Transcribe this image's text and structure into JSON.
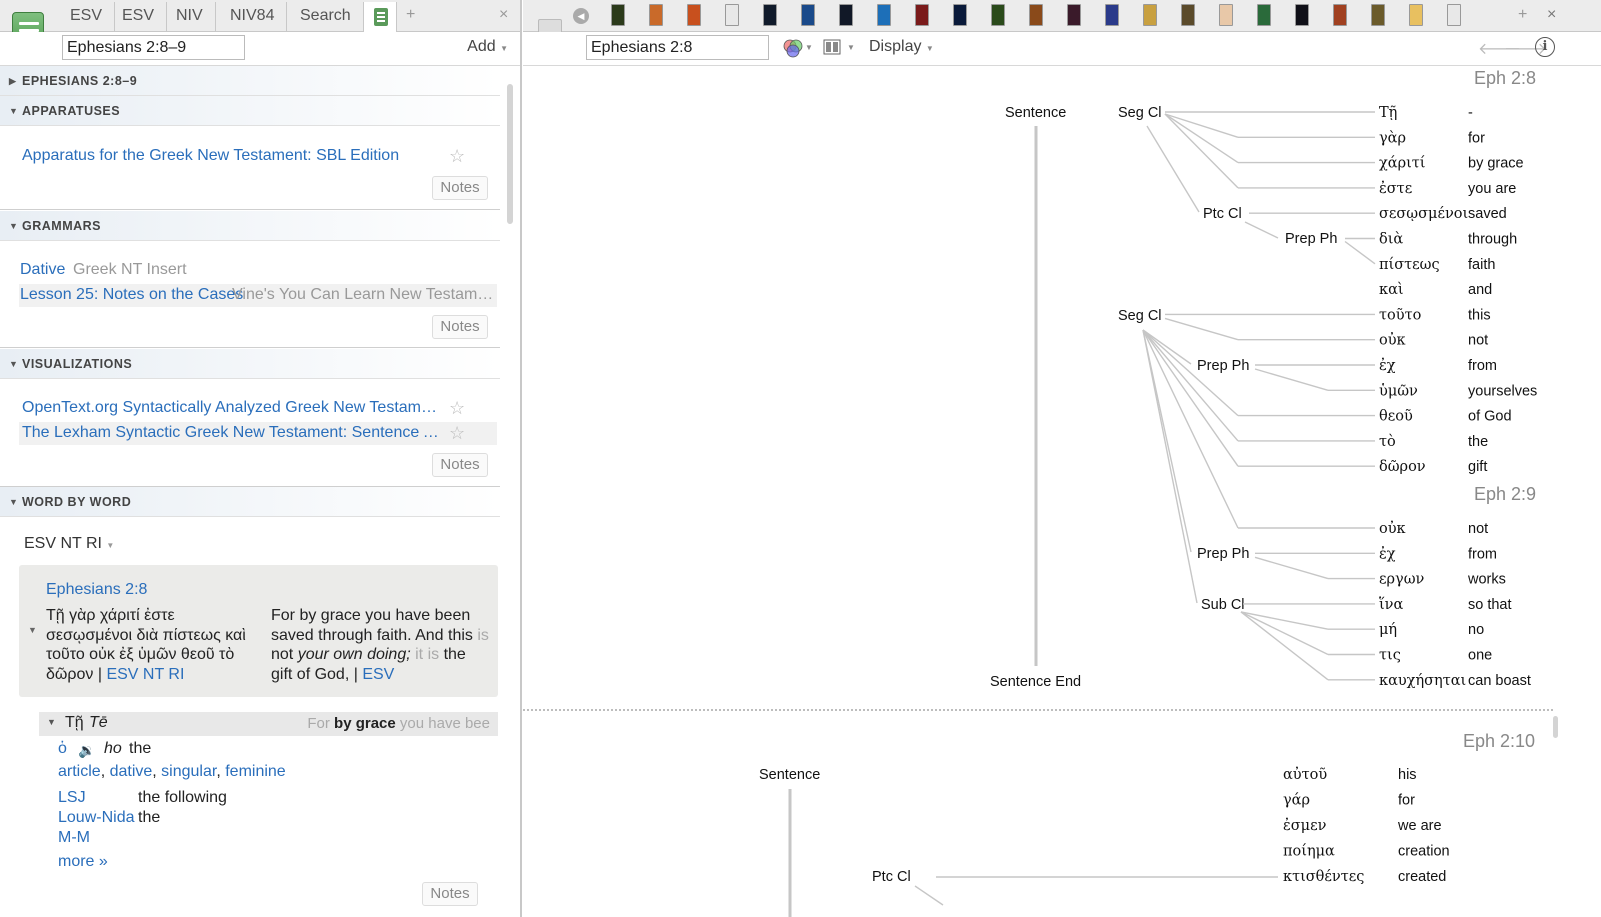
{
  "left": {
    "tabs": [
      "ESV",
      "ESV",
      "NIV",
      "NIV84",
      "Search"
    ],
    "reference": "Ephesians 2:8–9",
    "add_label": "Add",
    "sections": {
      "passage": "EPHESIANS 2:8–9",
      "apparatuses": "APPARATUSES",
      "grammars": "GRAMMARS",
      "visualizations": "VISUALIZATIONS",
      "word_by_word": "WORD BY WORD"
    },
    "apparatus_item": "Apparatus for the Greek New Testament: SBL Edition",
    "grammar_items": [
      {
        "title": "Dative",
        "source": "Greek NT Insert"
      },
      {
        "title": "Lesson 25: Notes on the Cases",
        "source": "Vine's You Can Learn New Testament..."
      }
    ],
    "visualization_items": [
      "OpenText.org Syntactically Analyzed Greek New Testament:...",
      "The Lexham Syntactic Greek New Testament: Sentence Ana..."
    ],
    "notes_label": "Notes",
    "wbw": {
      "resource": "ESV NT RI",
      "verse_ref": "Ephesians 2:8",
      "greek": "Τῇ γὰρ χάριτί ἐστε σεσῳσμένοι διὰ πίστεως καὶ τοῦτο οὐκ ἐξ ὑμῶν θεοῦ τὸ δῶρον",
      "greek_src": "ESV NT RI",
      "eng_1": "For by grace you have been saved through faith. And this",
      "eng_is": "is",
      "eng_2": "not",
      "eng_italic": "your own doing;",
      "eng_itis": "it is",
      "eng_3": "the gift of God,",
      "eng_src": "ESV",
      "word_greek": "Τῇ",
      "word_translit": "Tē",
      "ctx_pre": "For",
      "ctx_bold": "by grace",
      "ctx_post": "you have bee",
      "lemma": "ὁ",
      "lemma_translit": "ho",
      "lemma_gloss": "the",
      "parsing": [
        "article",
        "dative",
        "singular",
        "feminine"
      ],
      "lexicons": [
        {
          "name": "LSJ",
          "def": "the following"
        },
        {
          "name": "Louw-Nida",
          "def": "the"
        },
        {
          "name": "M-M",
          "def": ""
        }
      ],
      "more": "more »"
    }
  },
  "right": {
    "reference": "Ephesians 2:8",
    "display_label": "Display",
    "book_colors": [
      "#2b3a1a",
      "#c96a2a",
      "#c8501e",
      "#e8e8e8",
      "#101a2a",
      "#1a4a8a",
      "#111827",
      "#1d6fb8",
      "#7a1a1a",
      "#0a1a3a",
      "#2a4a1a",
      "#8a4a1a",
      "#3a1a2a",
      "#2a3a8a",
      "#c8a040",
      "#5a4a2a",
      "#e8c8a8",
      "#2a6a3a",
      "#101018",
      "#a04020",
      "#6a5a2a",
      "#e8c060",
      "#e8e8e8"
    ],
    "diagram1": {
      "verse_ref_1": "Eph 2:8",
      "verse_ref_2": "Eph 2:9",
      "sentence": "Sentence",
      "sentence_end": "Sentence End",
      "nodes": {
        "seg1": "Seg Cl",
        "ptc": "Ptc Cl",
        "prep1": "Prep Ph",
        "seg2": "Seg Cl",
        "prep2": "Prep Ph",
        "prep3": "Prep Ph",
        "sub": "Sub Cl"
      },
      "words": [
        {
          "gk": "Τῇ",
          "en": "-"
        },
        {
          "gk": "γὰρ",
          "en": "for"
        },
        {
          "gk": "χάριτί",
          "en": "by grace"
        },
        {
          "gk": "ἐστε",
          "en": "you are"
        },
        {
          "gk": "σεσῳσμένοι",
          "en": "saved"
        },
        {
          "gk": "διὰ",
          "en": "through"
        },
        {
          "gk": "πίστεως",
          "en": "faith"
        },
        {
          "gk": "καὶ",
          "en": "and"
        },
        {
          "gk": "τοῦτο",
          "en": "this"
        },
        {
          "gk": "οὐκ",
          "en": "not"
        },
        {
          "gk": "ἐχ",
          "en": "from"
        },
        {
          "gk": "ὑμῶν",
          "en": "yourselves"
        },
        {
          "gk": "θεοῦ",
          "en": "of God"
        },
        {
          "gk": "τὸ",
          "en": "the"
        },
        {
          "gk": "δῶρον",
          "en": "gift"
        },
        {
          "gk": "οὐκ",
          "en": "not"
        },
        {
          "gk": "ἐχ",
          "en": "from"
        },
        {
          "gk": "εργων",
          "en": "works"
        },
        {
          "gk": "ἵνα",
          "en": "so that"
        },
        {
          "gk": "μή",
          "en": "no"
        },
        {
          "gk": "τις",
          "en": "one"
        },
        {
          "gk": "καυχήσηται",
          "en": "can boast"
        }
      ]
    },
    "diagram2": {
      "verse_ref": "Eph 2:10",
      "sentence": "Sentence",
      "nodes": {
        "ptc": "Ptc Cl"
      },
      "words": [
        {
          "gk": "αὐτοῦ",
          "en": "his"
        },
        {
          "gk": "γάρ",
          "en": "for"
        },
        {
          "gk": "ἐσμεν",
          "en": "we are"
        },
        {
          "gk": "ποίημα",
          "en": "creation"
        },
        {
          "gk": "κτισθέντες",
          "en": "created"
        }
      ]
    }
  }
}
